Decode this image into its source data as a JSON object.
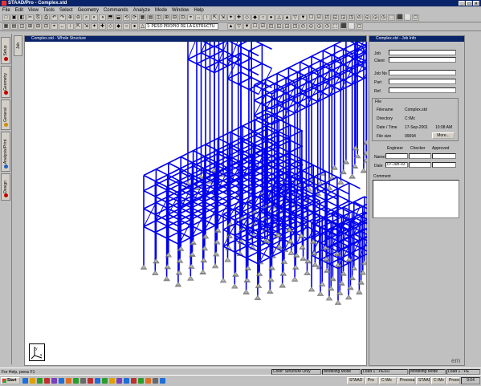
{
  "window": {
    "title": "STAAD/Pro - Complex.std"
  },
  "menu": [
    "File",
    "Edit",
    "View",
    "Tools",
    "Select",
    "Geometry",
    "Commands",
    "Analyze",
    "Mode",
    "Window",
    "Help"
  ],
  "toolbar": {
    "loadcase": "1: PESO PROPIO DE LA ESTRUCTU"
  },
  "side_tabs": [
    {
      "label": "Setup",
      "color": "#c00000"
    },
    {
      "label": "Geometry",
      "color": "#c00000"
    },
    {
      "label": "General",
      "color": "#d09000"
    },
    {
      "label": "Analysis/Print",
      "color": "#2060c0"
    },
    {
      "label": "Design",
      "color": "#c00000"
    },
    {
      "label": "Job",
      "color": "#606060"
    }
  ],
  "structure_window": {
    "title": "Complex.std - Whole Structure"
  },
  "job_panel": {
    "title": "Complex.std - Job Info",
    "fields": [
      {
        "label": "Job",
        "value": ""
      },
      {
        "label": "Client",
        "value": ""
      },
      {
        "label": "Job No",
        "value": ""
      },
      {
        "label": "Part",
        "value": ""
      },
      {
        "label": "Ref",
        "value": ""
      }
    ],
    "file_group_label": "File",
    "file_info": [
      {
        "label": "Filename",
        "value": "Complex.std"
      },
      {
        "label": "Directory",
        "value": "C:\\Mc"
      },
      {
        "label": "Date / Time",
        "value": "17-Sep-2001",
        "time": "10:08 AM"
      },
      {
        "label": "File size",
        "value": "99094"
      }
    ],
    "more_button": "More...",
    "columns": [
      "Engineer",
      "Checker",
      "Approved"
    ],
    "rows": [
      {
        "label": "Name",
        "values": [
          "",
          "",
          ""
        ]
      },
      {
        "label": "Date",
        "values": [
          "07-Jun-03",
          "",
          ""
        ]
      }
    ],
    "comment_label": "Comment",
    "watermark": "em"
  },
  "status": {
    "help": "For Help, press F1",
    "color": "Color: Structure Only",
    "mode1": "Modeling Mode",
    "load1": "Load 1 : PESO",
    "mode2": "Modeling Mode",
    "load2": "Load 1 : PE"
  },
  "taskbar": {
    "start": "Start",
    "quick_launch_colors": [
      "#1e6fd9",
      "#e0a000",
      "#2a9d2a",
      "#c03030",
      "#7a3fbf",
      "#1e6fd9",
      "#e07020",
      "#2a9d2a",
      "#6a6a6a",
      "#c03030",
      "#1e6fd9",
      "#2a9d2a",
      "#e0a000",
      "#7a3fbf",
      "#1e6fd9",
      "#c03030",
      "#2a9d2a",
      "#e07020",
      "#6a6a6a",
      "#1e6fd9"
    ],
    "buttons": [
      "STAAD",
      "Pro",
      "C:\\Mc",
      "Procesador",
      "STAAD",
      "C:\\Mc",
      "Procesador"
    ],
    "tray": "9:04"
  },
  "structure_color": "#0000ee"
}
